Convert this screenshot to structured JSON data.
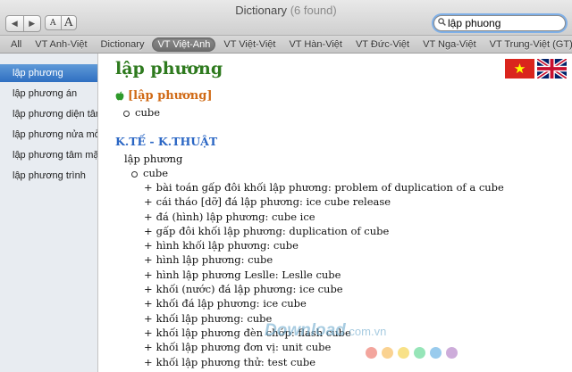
{
  "window": {
    "title": "Dictionary",
    "count": "(6 found)"
  },
  "toolbar": {
    "back_glyph": "◀",
    "forward_glyph": "▶",
    "font_small": "A",
    "font_large": "A"
  },
  "search": {
    "value": "lập phuong",
    "icon": "magnifier-icon"
  },
  "tabs": [
    {
      "label": "All"
    },
    {
      "label": "VT Anh-Việt"
    },
    {
      "label": "Dictionary"
    },
    {
      "label": "VT Việt-Anh",
      "active": true
    },
    {
      "label": "VT Việt-Việt"
    },
    {
      "label": "VT Hàn-Việt"
    },
    {
      "label": "VT Đức-Việt"
    },
    {
      "label": "VT Nga-Việt"
    },
    {
      "label": "VT Trung-Việt (GT)"
    },
    {
      "label": "VT"
    }
  ],
  "sidebar": {
    "items": [
      {
        "label": "lập phương",
        "active": true
      },
      {
        "label": "lập phương án"
      },
      {
        "label": "lập phương diện tâm"
      },
      {
        "label": "lập phương nửa mở"
      },
      {
        "label": "lập phương tâm mặt"
      },
      {
        "label": "lập phương trình"
      }
    ]
  },
  "entry": {
    "headword": "lập phương",
    "flags": {
      "vietnam_colors": [
        "#da251d",
        "#ffff00"
      ],
      "uk_colors": [
        "#012169",
        "#ffffff",
        "#c8102e"
      ]
    },
    "section1": {
      "label": "[lập phương]",
      "icon": "apple-icon",
      "sense": "cube"
    },
    "section2": {
      "heading": "K.TẾ - K.THUẬT",
      "word": "lập phương",
      "sense": "cube",
      "phrases": [
        "bài toán gấp đôi khối lập phương: problem of duplication of a cube",
        "cái tháo [dỡ] đá lập phương: ice cube release",
        "đá (hình) lập phương: cube ice",
        "gấp đôi khối lập phương: duplication of cube",
        "hình khối lập phương: cube",
        "hình lập phương: cube",
        "hình lập phương Leslle: Leslle cube",
        "khối (nước) đá lập phương: ice cube",
        "khối đá lập phương: ice cube",
        "khối lập phương: cube",
        "khối lập phương đèn chớp: flash cube",
        "khối lập phương đơn vị: unit cube",
        "khối lập phương thử: test cube"
      ]
    }
  },
  "watermark": {
    "text": "Download",
    "domain": ".com.vn",
    "dot_colors": [
      "#e74c3c",
      "#f5a623",
      "#f1c40f",
      "#2ecc71",
      "#3498db",
      "#9b59b6"
    ]
  },
  "colors": {
    "accent": "#2f6fc1",
    "headword": "#2e7a1e",
    "subhead": "#2a66c4",
    "bracket": "#d06a16"
  }
}
